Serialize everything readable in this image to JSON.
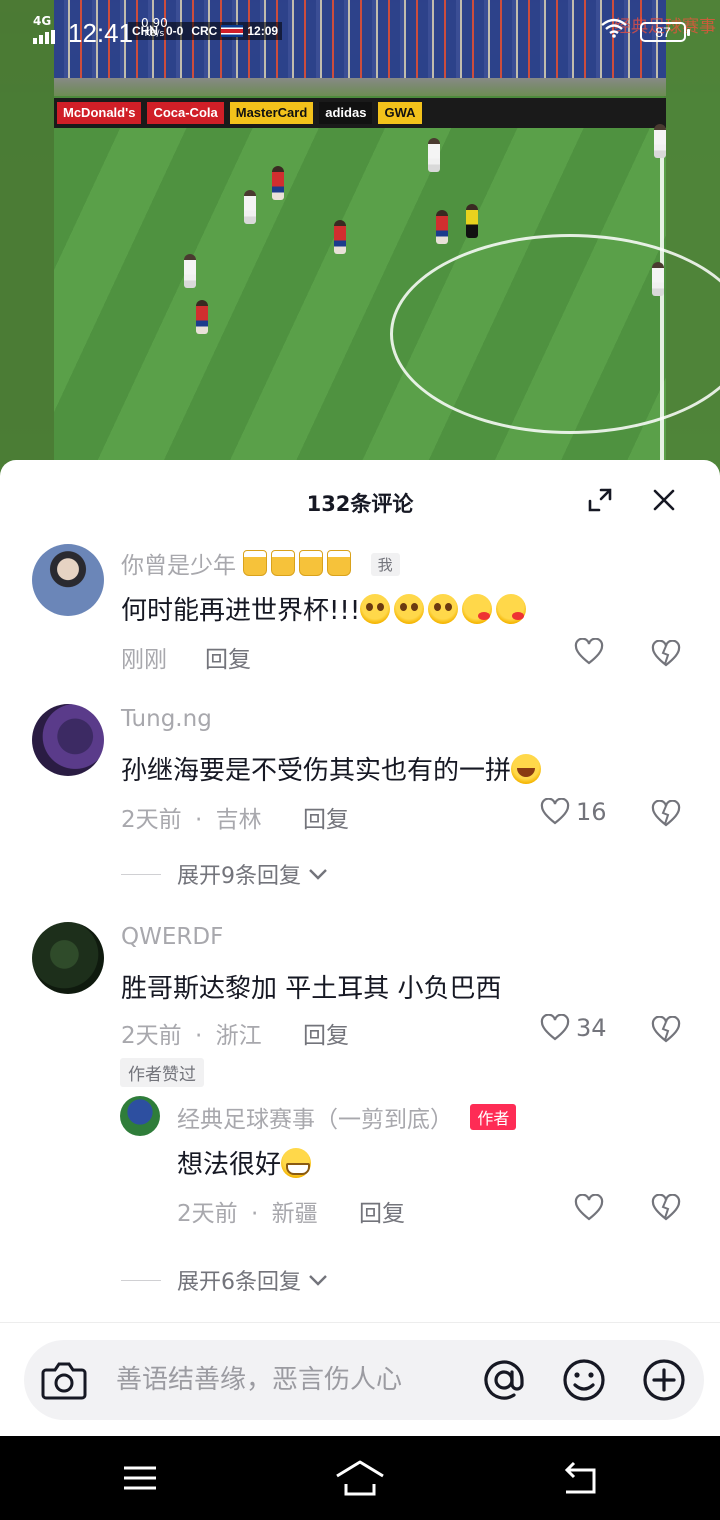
{
  "status_bar": {
    "network": "4G",
    "time": "12:41",
    "speed_value": "0.90",
    "speed_unit": "KB/s",
    "battery": "87"
  },
  "video": {
    "scorebug_left": "CHN",
    "scorebug_score": "0-0",
    "scorebug_right": "CRC",
    "scorebug_clock": "12:09",
    "watermark": "经典足球赛事",
    "ads": [
      "McDonald's",
      "Coca-Cola",
      "MasterCard",
      "adidas",
      "GWA"
    ]
  },
  "comments_panel": {
    "title": "132条评论",
    "comments": [
      {
        "author": "你曾是少年",
        "author_badge": "我",
        "text": "何时能再进世界杯!!!",
        "time": "刚刚",
        "reply_label": "回复",
        "likes": ""
      },
      {
        "author": "Tung.ng",
        "text": "孙继海要是不受伤其实也有的一拼",
        "time": "2天前",
        "location": "吉林",
        "reply_label": "回复",
        "likes": "16",
        "expand_replies": "展开9条回复"
      },
      {
        "author": "QWERDF",
        "text": "胜哥斯达黎加 平土耳其 小负巴西",
        "time": "2天前",
        "location": "浙江",
        "reply_label": "回复",
        "likes": "34",
        "liked_by_author_tag": "作者赞过",
        "reply": {
          "author": "经典足球赛事（一剪到底）",
          "author_badge": "作者",
          "text": "想法很好",
          "time": "2天前",
          "location": "新疆",
          "reply_label": "回复"
        },
        "expand_replies": "展开6条回复"
      }
    ],
    "meta_separator": "·"
  },
  "input_bar": {
    "placeholder": "善语结善缘，恶言伤人心"
  },
  "icons": {
    "expand": "expand-icon",
    "close": "close-icon",
    "like": "heart-icon",
    "dislike": "broken-heart-icon",
    "camera": "camera-icon",
    "mention": "at-icon",
    "emoji": "emoji-icon",
    "plus": "plus-icon"
  },
  "colors": {
    "author_badge": "#fe2c55",
    "text_primary": "#161823",
    "text_secondary": "#a8a8ad"
  }
}
